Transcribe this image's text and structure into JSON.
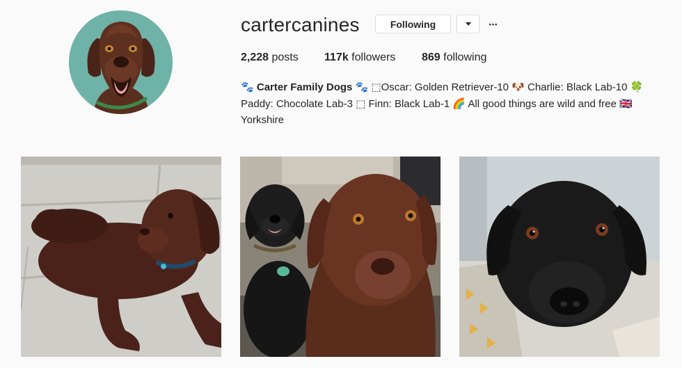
{
  "profile": {
    "username": "cartercanines",
    "following_button": "Following",
    "more_glyph": "•••"
  },
  "stats": {
    "posts_count": "2,228",
    "posts_label": " posts",
    "followers_count": "117k",
    "followers_label": " followers",
    "following_count": "869",
    "following_label": " following"
  },
  "bio": {
    "line1_prefix": "🐾 ",
    "name": "Carter Family Dogs",
    "line1_rest": " 🐾 ⬚Oscar: Golden Retriever-10 🐶 Charlie: Black Lab-10 🍀",
    "line2": "Paddy: Chocolate Lab-3 ⬚ Finn: Black Lab-1 🌈 All good things are wild and free 🇬🇧",
    "line3": "Yorkshire"
  },
  "posts": [
    {
      "icon": "chocolate-lab-photo"
    },
    {
      "icon": "two-labs-photo"
    },
    {
      "icon": "black-lab-photo"
    }
  ],
  "colors": {
    "avatar_bg": "#6fb2a8",
    "border": "#dbdbdb",
    "text": "#262626"
  }
}
